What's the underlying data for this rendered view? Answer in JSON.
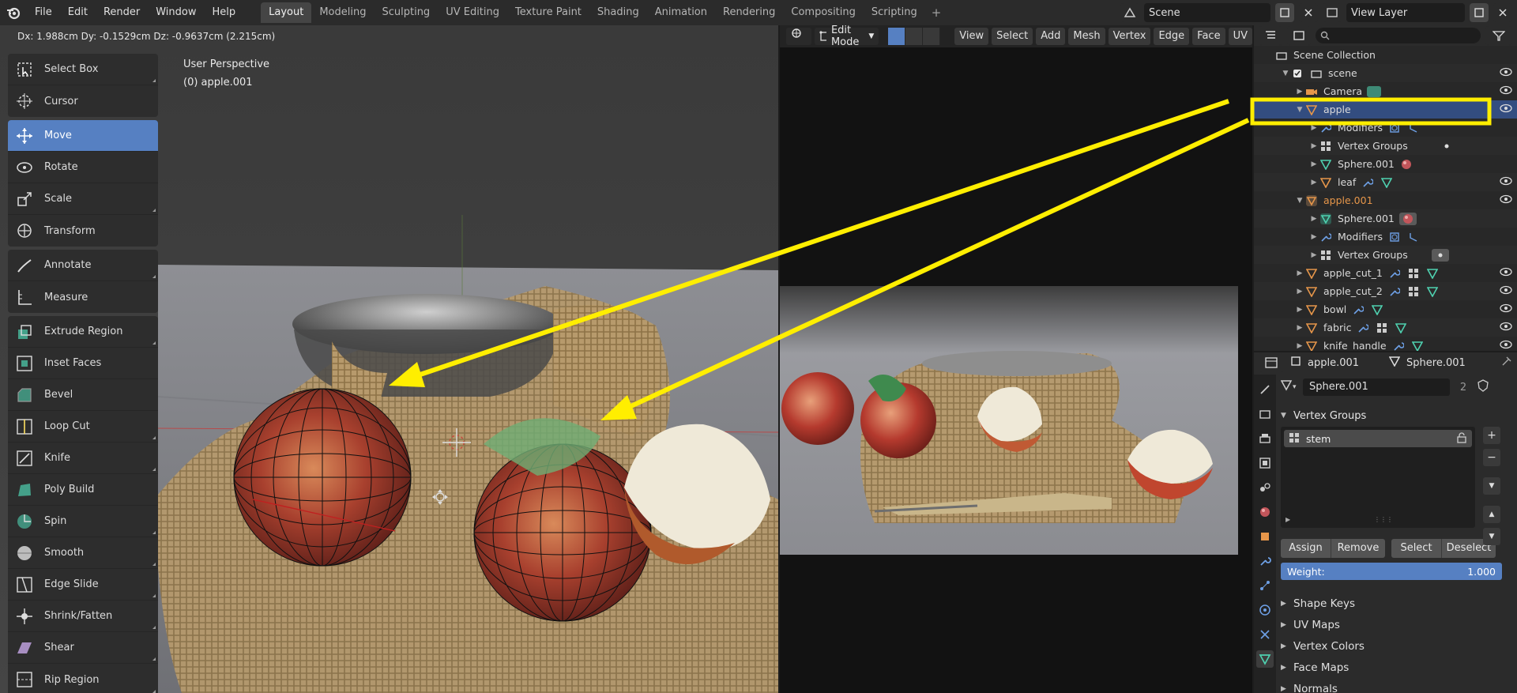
{
  "menu": {
    "file": "File",
    "edit": "Edit",
    "render": "Render",
    "window": "Window",
    "help": "Help"
  },
  "workspaces": [
    "Layout",
    "Modeling",
    "Sculpting",
    "UV Editing",
    "Texture Paint",
    "Shading",
    "Animation",
    "Rendering",
    "Compositing",
    "Scripting"
  ],
  "active_workspace": "Layout",
  "scene_name": "Scene",
  "view_layer": "View Layer",
  "viewport": {
    "header_text": "Dx: 1.988cm   Dy: -0.1529cm   Dz: -0.9637cm (2.215cm)",
    "perspective": "User Perspective",
    "object_label": "(0) apple.001"
  },
  "tools": {
    "select_box": "Select Box",
    "cursor": "Cursor",
    "move": "Move",
    "rotate": "Rotate",
    "scale": "Scale",
    "transform": "Transform",
    "annotate": "Annotate",
    "measure": "Measure",
    "extrude_region": "Extrude Region",
    "inset_faces": "Inset Faces",
    "bevel": "Bevel",
    "loop_cut": "Loop Cut",
    "knife": "Knife",
    "poly_build": "Poly Build",
    "spin": "Spin",
    "smooth": "Smooth",
    "edge_slide": "Edge Slide",
    "shrink_fatten": "Shrink/Fatten",
    "shear": "Shear",
    "rip_region": "Rip Region"
  },
  "render_header": {
    "mode": "Edit Mode",
    "view": "View",
    "select": "Select",
    "add": "Add",
    "mesh": "Mesh",
    "vertex": "Vertex",
    "edge": "Edge",
    "face": "Face",
    "uv": "UV"
  },
  "outliner": {
    "scene_collection": "Scene Collection",
    "scene": "scene",
    "camera": "Camera",
    "apple": "apple",
    "modifiers_1": "Modifiers",
    "vertex_groups_1": "Vertex Groups",
    "sphere_1": "Sphere.001",
    "leaf": "leaf",
    "apple_001": "apple.001",
    "sphere_2": "Sphere.001",
    "modifiers_2": "Modifiers",
    "vertex_groups_2": "Vertex Groups",
    "apple_cut_1": "apple_cut_1",
    "apple_cut_2": "apple_cut_2",
    "bowl": "bowl",
    "fabric": "fabric",
    "knife_handle": "knife_handle"
  },
  "properties": {
    "object_name": "apple.001",
    "mesh_name": "Sphere.001",
    "data_field": "Sphere.001",
    "users": "2",
    "vertex_groups_title": "Vertex Groups",
    "vg_item": "stem",
    "assign": "Assign",
    "remove": "Remove",
    "select": "Select",
    "deselect": "Deselect",
    "weight_label": "Weight:",
    "weight_value": "1.000",
    "shape_keys": "Shape Keys",
    "uv_maps": "UV Maps",
    "vertex_colors": "Vertex Colors",
    "face_maps": "Face Maps",
    "normals": "Normals"
  },
  "colors": {
    "accent_blue": "#5680c2",
    "annotation_yellow": "#ffee00",
    "object_orange": "#e6964a",
    "data_green": "#4fd1b0"
  }
}
